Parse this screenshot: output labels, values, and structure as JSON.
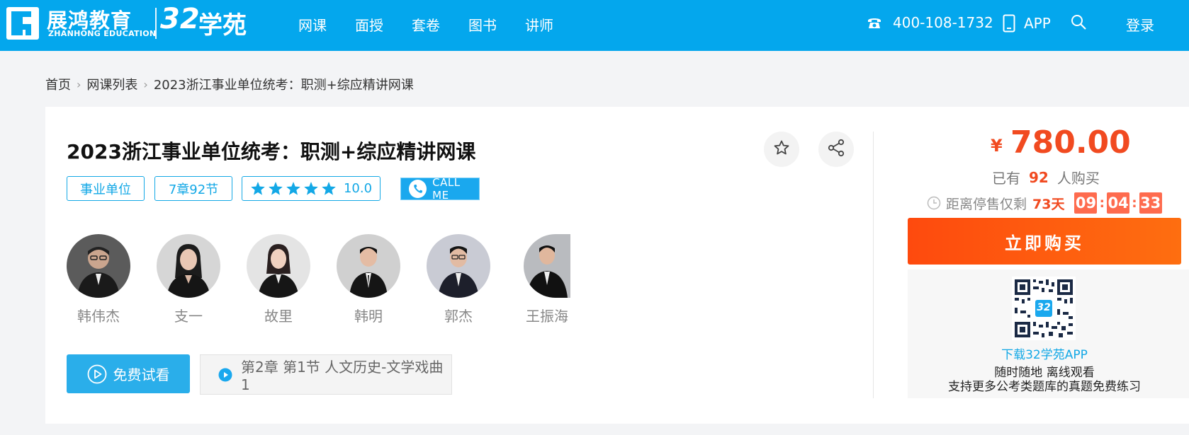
{
  "header": {
    "logo_cn": "展鸿教育",
    "logo_en": "ZHANHONG EDUCATION",
    "logo_32": "32",
    "logo_xueyuan": "学苑",
    "nav": [
      "网课",
      "面授",
      "套卷",
      "图书",
      "讲师"
    ],
    "phone": "400-108-1732",
    "app": "APP",
    "login": "登录"
  },
  "breadcrumb": [
    "首页",
    "网课列表",
    "2023浙江事业单位统考：职测+综应精讲网课"
  ],
  "course": {
    "title": "2023浙江事业单位统考：职测+综应精讲网课",
    "tags": [
      "事业单位",
      "7章92节"
    ],
    "rating": "10.0",
    "call_me": "CALL ME"
  },
  "teachers": [
    {
      "name": "韩伟杰"
    },
    {
      "name": "支一"
    },
    {
      "name": "故里"
    },
    {
      "name": "韩明"
    },
    {
      "name": "郭杰"
    },
    {
      "name": "王振海"
    }
  ],
  "free_trial": "免费试看",
  "current_lesson": "第2章 第1节 人文历史-文学戏曲1",
  "purchase": {
    "currency": "¥",
    "price": "780.00",
    "bought_prefix": "已有",
    "bought_count": "92",
    "bought_suffix": "人购买",
    "countdown_label": "距离停售仅剩",
    "days": "73天",
    "hours": "09",
    "minutes": "04",
    "seconds": "33",
    "buy_label": "立即购买",
    "qr_badge": "32",
    "app_download": "下载32学苑APP",
    "app_line2": "随时随地 离线观看",
    "app_line3": "支持更多公考类题库的真题免费练习"
  },
  "colors": {
    "header_bg": "#04a7ed",
    "accent": "#13a8e6",
    "price": "#f14a20",
    "buy_button": "#fe5a0f"
  }
}
